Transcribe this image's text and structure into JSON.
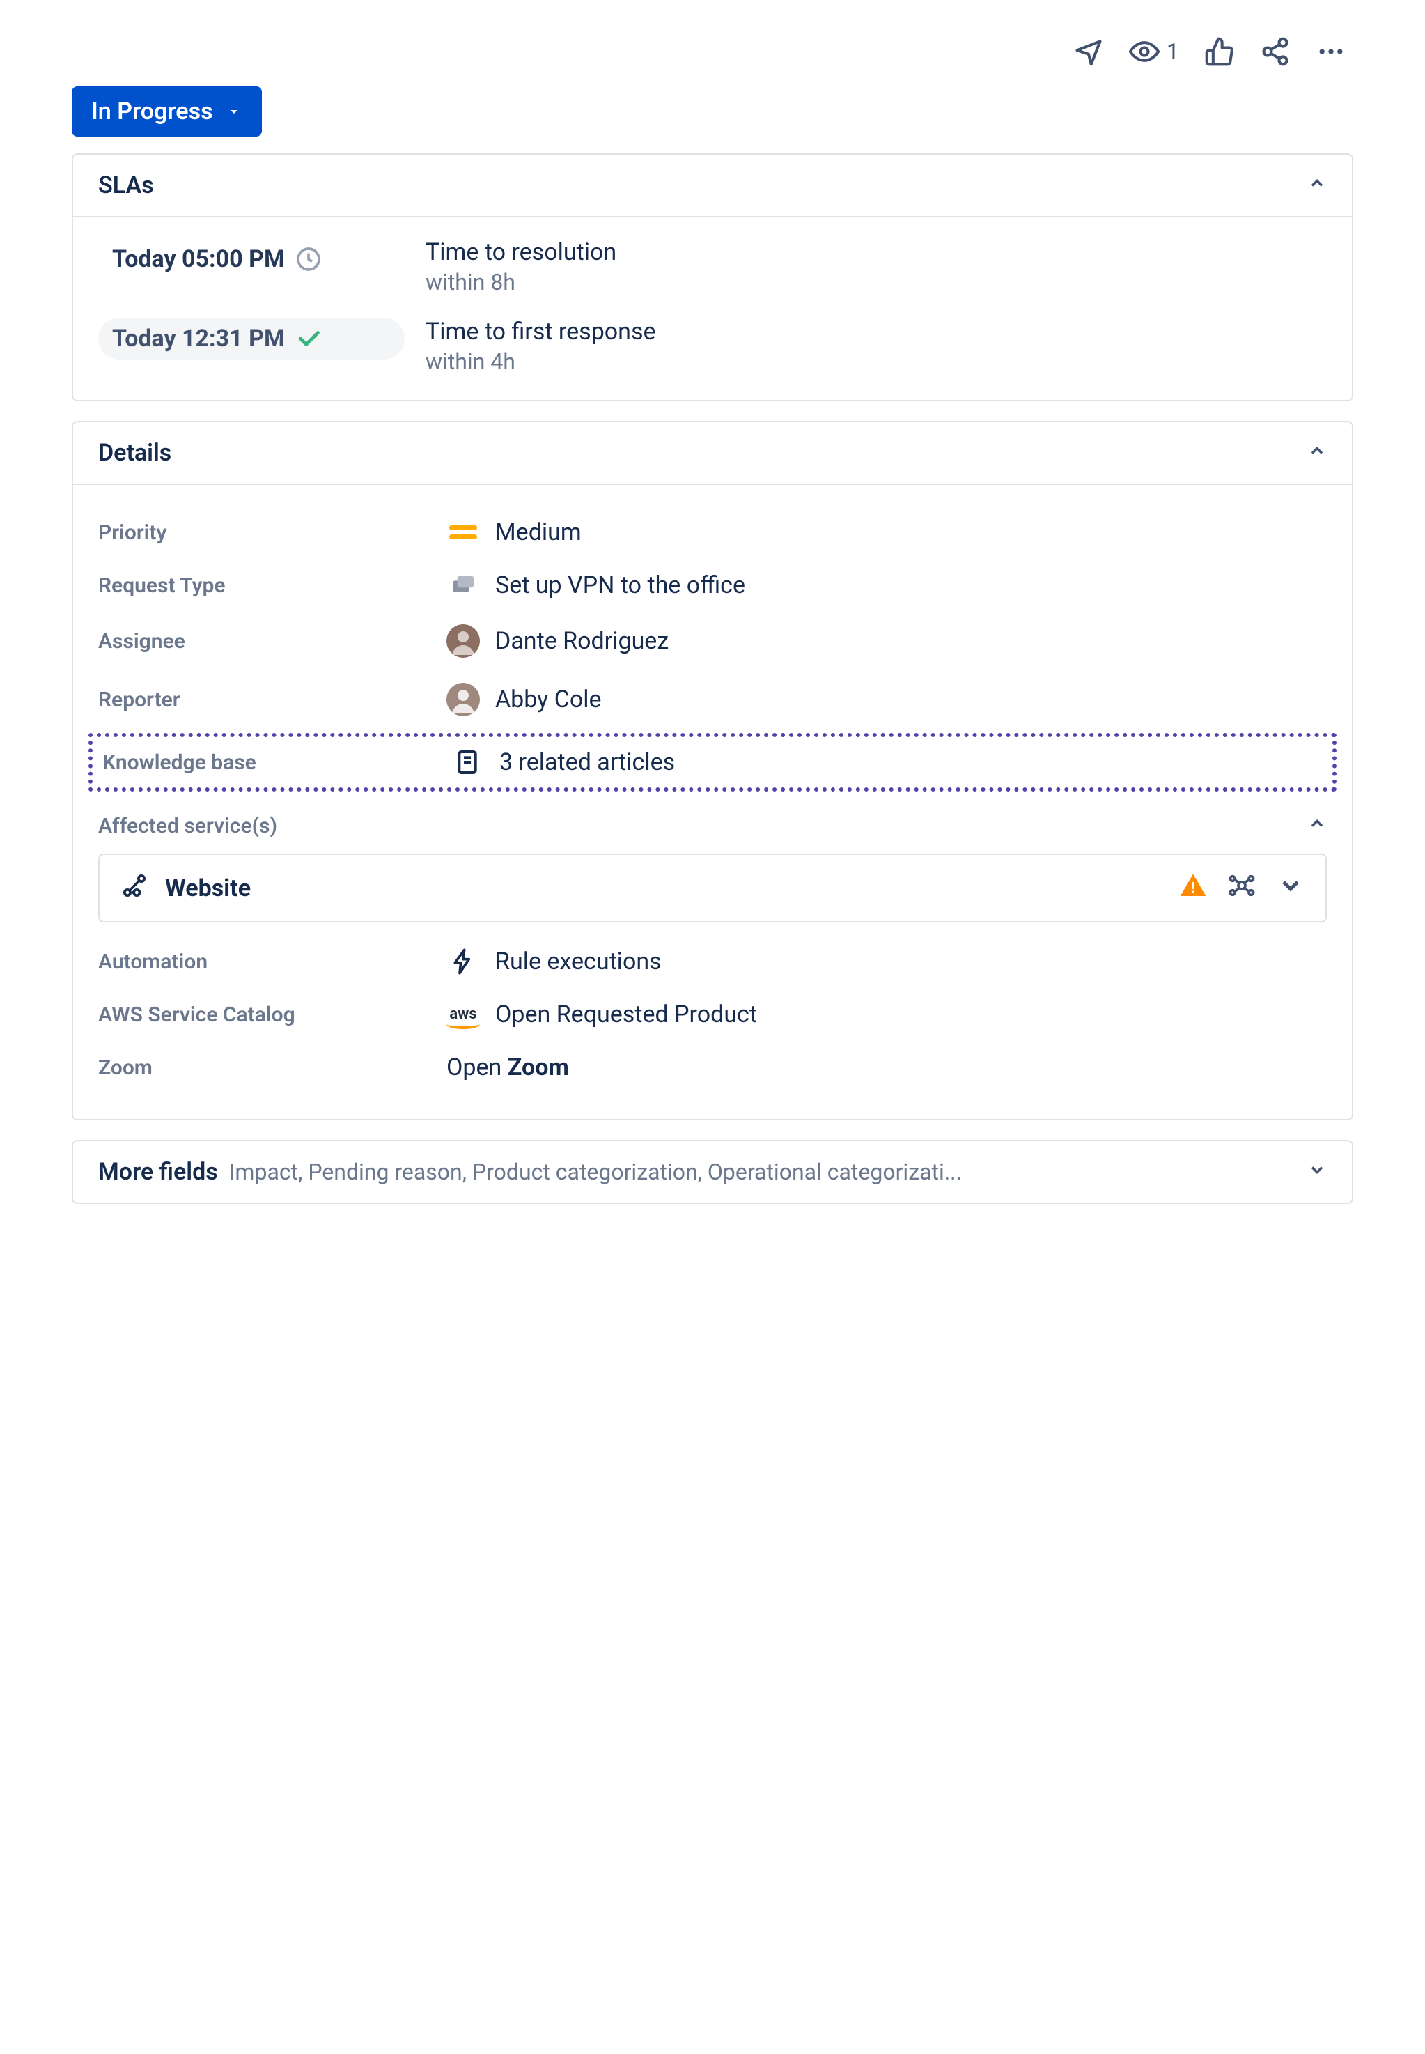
{
  "topbar": {
    "watch_count": "1"
  },
  "status": {
    "label": "In Progress"
  },
  "slas": {
    "title": "SLAs",
    "items": [
      {
        "time": "Today 05:00 PM",
        "label": "Time to resolution",
        "goal": "within 8h",
        "status": "pending"
      },
      {
        "time": "Today 12:31 PM",
        "label": "Time to first response",
        "goal": "within 4h",
        "status": "met"
      }
    ]
  },
  "details": {
    "title": "Details",
    "priority": {
      "label": "Priority",
      "value": "Medium"
    },
    "request_type": {
      "label": "Request Type",
      "value": "Set up VPN to the office"
    },
    "assignee": {
      "label": "Assignee",
      "value": "Dante Rodriguez"
    },
    "reporter": {
      "label": "Reporter",
      "value": "Abby Cole"
    },
    "knowledge_base": {
      "label": "Knowledge base",
      "value": "3 related articles"
    },
    "affected_services": {
      "label": "Affected service(s)",
      "items": [
        {
          "name": "Website",
          "warning": true
        }
      ]
    },
    "automation": {
      "label": "Automation",
      "value": "Rule executions"
    },
    "aws_catalog": {
      "label": "AWS Service Catalog",
      "value": "Open Requested Product"
    },
    "zoom": {
      "label": "Zoom",
      "prefix": "Open ",
      "bold": "Zoom"
    }
  },
  "more_fields": {
    "title": "More fields",
    "summary": "Impact, Pending reason, Product categorization, Operational categorizati..."
  }
}
